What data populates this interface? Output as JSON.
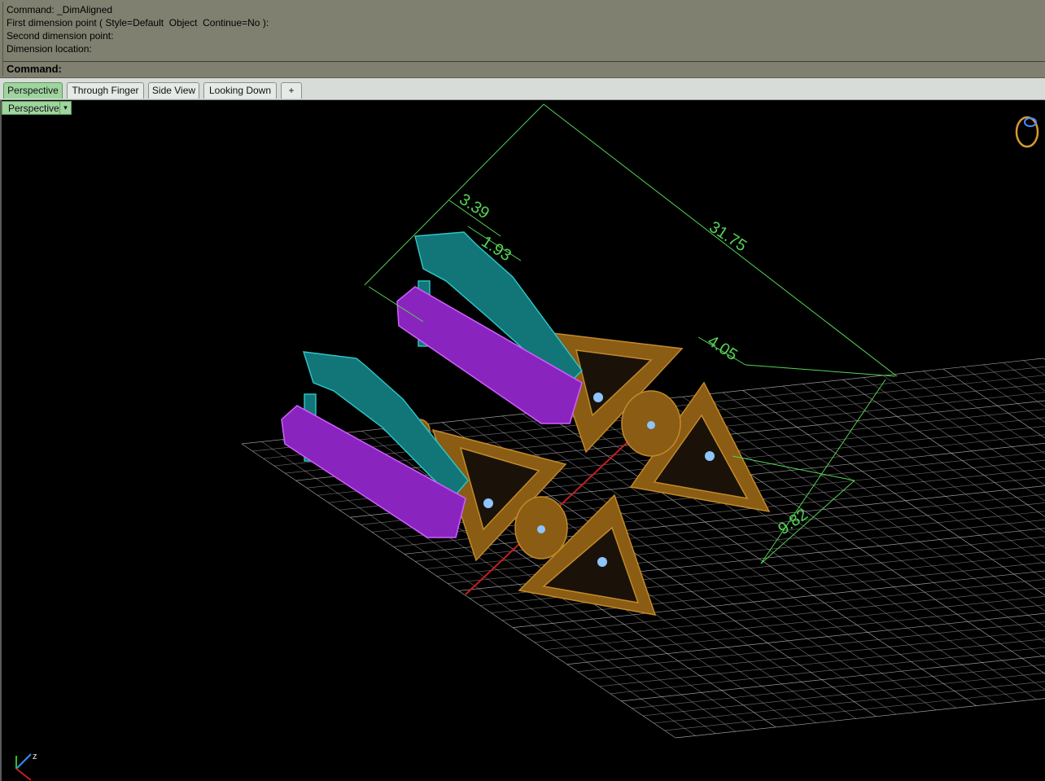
{
  "command_panel": {
    "history": [
      "Command: _DimAligned",
      "First dimension point ( Style=Default  Object  Continue=No ):",
      "Second dimension point:",
      "Dimension location:"
    ],
    "prompt_label": "Command:"
  },
  "tabs": [
    {
      "label": "Perspective",
      "active": true
    },
    {
      "label": "Through Finger",
      "active": false
    },
    {
      "label": "Side View",
      "active": false
    },
    {
      "label": "Looking Down",
      "active": false
    }
  ],
  "add_tab_glyph": "+",
  "viewport": {
    "label": "Perspective",
    "dropdown_glyph": "▾",
    "dimensions": {
      "overall": "31.75",
      "width_a": "3.39",
      "width_b": "1.93",
      "gap": "4.05",
      "height": "9.82"
    },
    "axis_label": "z"
  },
  "colors": {
    "grid": "#b4b4b4",
    "dimension": "#54d454",
    "gold": "#946518",
    "teal": "#1a8a8c",
    "purple": "#9a30c8",
    "axis_x": "#c81e1e",
    "active_tab": "#9fd49f"
  }
}
